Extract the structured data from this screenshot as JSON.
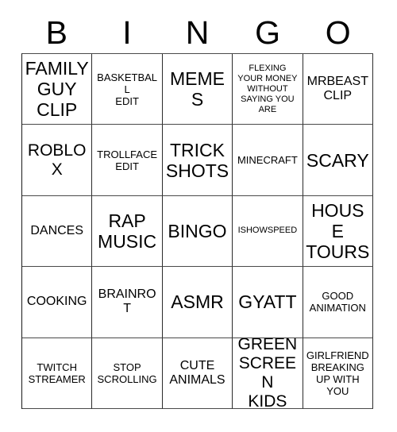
{
  "card": {
    "title": "BINGO",
    "header_letters": [
      "B",
      "I",
      "N",
      "G",
      "O"
    ],
    "colors": {
      "background": "#ffffff",
      "text": "#000000",
      "grid_line": "#2b2b2b"
    },
    "rows": [
      [
        {
          "text": "FAMILY\nGUY\nCLIP",
          "size": "xl"
        },
        {
          "text": "BASKETBALL\nEDIT",
          "size": "sm"
        },
        {
          "text": "MEMES",
          "size": "xl"
        },
        {
          "text": "FLEXING\nYOUR MONEY\nWITHOUT\nSAYING YOU\nARE",
          "size": "xs"
        },
        {
          "text": "MRBEAST\nCLIP",
          "size": "md"
        }
      ],
      [
        {
          "text": "ROBLOX",
          "size": "lg"
        },
        {
          "text": "TROLLFACE\nEDIT",
          "size": "sm"
        },
        {
          "text": "TRICK\nSHOTS",
          "size": "xl"
        },
        {
          "text": "MINECRAFT",
          "size": "sm"
        },
        {
          "text": "SCARY",
          "size": "xl"
        }
      ],
      [
        {
          "text": "DANCES",
          "size": "md"
        },
        {
          "text": "RAP\nMUSIC",
          "size": "xl"
        },
        {
          "text": "BINGO",
          "size": "xl"
        },
        {
          "text": "ISHOWSPEED",
          "size": "xs"
        },
        {
          "text": "HOUSE\nTOURS",
          "size": "xl"
        }
      ],
      [
        {
          "text": "COOKING",
          "size": "md"
        },
        {
          "text": "BRAINROT",
          "size": "md"
        },
        {
          "text": "ASMR",
          "size": "xl"
        },
        {
          "text": "GYATT",
          "size": "xl"
        },
        {
          "text": "GOOD\nANIMATION",
          "size": "sm"
        }
      ],
      [
        {
          "text": "TWITCH\nSTREAMER",
          "size": "sm"
        },
        {
          "text": "STOP\nSCROLLING",
          "size": "sm"
        },
        {
          "text": "CUTE\nANIMALS",
          "size": "md"
        },
        {
          "text": "GREEN\nSCREEN\nKIDS",
          "size": "lg"
        },
        {
          "text": "GIRLFRIEND\nBREAKING\nUP WITH\nYOU",
          "size": "sm"
        }
      ]
    ]
  }
}
